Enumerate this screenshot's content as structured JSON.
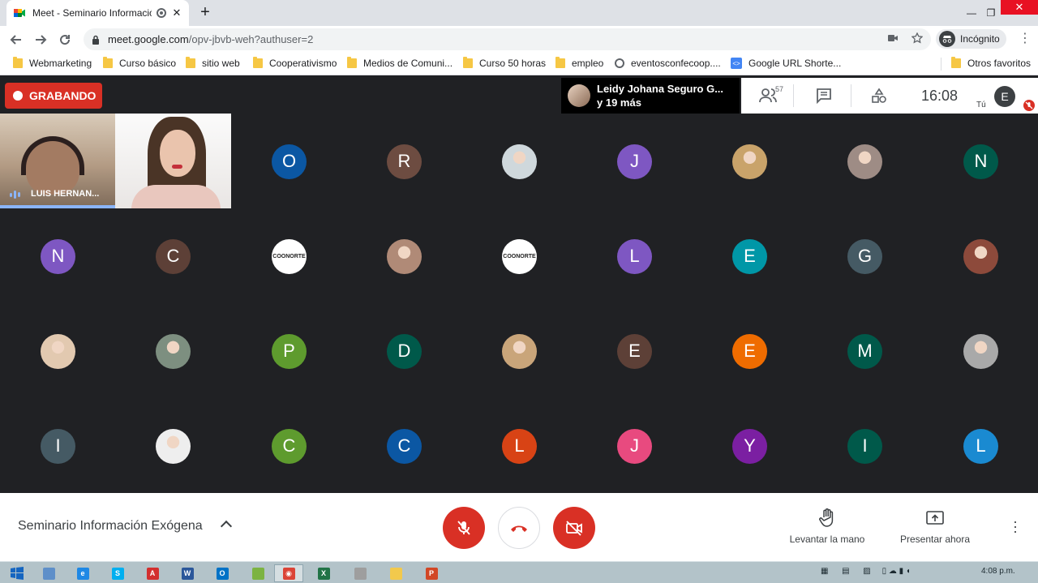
{
  "browser": {
    "tab_title": "Meet - Seminario Informació",
    "new_tab": "+",
    "close": "✕",
    "win_min": "—",
    "win_max": "❐",
    "win_close": "✕",
    "url_host": "meet.google.com",
    "url_path": "/opv-jbvb-weh?authuser=2",
    "profile_label": "Incógnito",
    "bookmarks": [
      {
        "label": "Webmarketing",
        "icon": "folder"
      },
      {
        "label": "Curso básico",
        "icon": "folder"
      },
      {
        "label": "sitio web",
        "icon": "folder"
      },
      {
        "label": "Cooperativismo",
        "icon": "folder"
      },
      {
        "label": "Medios de Comuni...",
        "icon": "folder"
      },
      {
        "label": "Curso 50 horas",
        "icon": "folder"
      },
      {
        "label": "empleo",
        "icon": "folder"
      },
      {
        "label": "eventosconfecoop....",
        "icon": "globe"
      },
      {
        "label": "Google URL Shorte...",
        "icon": "google"
      },
      {
        "label": "Otros favoritos",
        "icon": "folder"
      }
    ]
  },
  "meet": {
    "recording_label": "GRABANDO",
    "speaker_name": "Leidy Johana Seguro G...",
    "speaker_more": "y 19 más",
    "people_count": "57",
    "time": "16:08",
    "self_label": "Tú",
    "self_initial": "E",
    "meeting_name": "Seminario Información Exógena",
    "raise_hand": "Levantar la mano",
    "present_now": "Presentar ahora",
    "video_names": [
      "LUIS HERNAN..."
    ],
    "logo_text": "COONORTE",
    "participants": [
      {
        "initial": "O",
        "color": "#0b57a3"
      },
      {
        "initial": "R",
        "color": "#6d4c41"
      },
      {
        "photo": true,
        "color": "#cfd8dc"
      },
      {
        "initial": "J",
        "color": "#7e57c2"
      },
      {
        "photo": true,
        "color": "#c9a36a"
      },
      {
        "photo": true,
        "color": "#9e8c85"
      },
      {
        "initial": "N",
        "color": "#00594a"
      },
      {
        "initial": "N",
        "color": "#7e57c2"
      },
      {
        "initial": "C",
        "color": "#5d4037"
      },
      {
        "logo": true
      },
      {
        "photo": true,
        "color": "#b08a77"
      },
      {
        "logo": true
      },
      {
        "initial": "L",
        "color": "#7e57c2"
      },
      {
        "initial": "E",
        "color": "#0097a7"
      },
      {
        "initial": "G",
        "color": "#455a64"
      },
      {
        "photo": true,
        "color": "#8d4a3b"
      },
      {
        "photo": true,
        "color": "#e2c9b0"
      },
      {
        "photo": true,
        "color": "#7d8f80"
      },
      {
        "initial": "P",
        "color": "#5e9b2e"
      },
      {
        "initial": "D",
        "color": "#00594a"
      },
      {
        "photo": true,
        "color": "#c9a57a"
      },
      {
        "initial": "E",
        "color": "#5d4037"
      },
      {
        "initial": "E",
        "color": "#ef6c00"
      },
      {
        "initial": "M",
        "color": "#00594a"
      },
      {
        "photo": true,
        "color": "#a9a9a9"
      },
      {
        "initial": "I",
        "color": "#455a64"
      },
      {
        "photo": true,
        "color": "#eeeeee"
      },
      {
        "initial": "C",
        "color": "#5e9b2e"
      },
      {
        "initial": "C",
        "color": "#0b57a3"
      },
      {
        "initial": "L",
        "color": "#d84315"
      },
      {
        "initial": "J",
        "color": "#e84a7f"
      },
      {
        "initial": "Y",
        "color": "#7b1fa2"
      },
      {
        "initial": "I",
        "color": "#00594a"
      },
      {
        "initial": "L",
        "color": "#1a8ad1"
      }
    ]
  },
  "taskbar": {
    "clock": "4:08 p.m.",
    "apps": [
      {
        "label": "",
        "color": "#5e8fc9"
      },
      {
        "label": "e",
        "color": "#1e88e5"
      },
      {
        "label": "S",
        "color": "#00aff0"
      },
      {
        "label": "A",
        "color": "#d32f2f"
      },
      {
        "label": "W",
        "color": "#2b579a"
      },
      {
        "label": "O",
        "color": "#0072c6"
      },
      {
        "label": "",
        "color": "#7cb342"
      },
      {
        "label": "◉",
        "color": "#db4437"
      },
      {
        "label": "X",
        "color": "#217346"
      },
      {
        "label": "",
        "color": "#9e9e9e"
      },
      {
        "label": "",
        "color": "#f2c94c"
      },
      {
        "label": "P",
        "color": "#d24726"
      }
    ]
  }
}
